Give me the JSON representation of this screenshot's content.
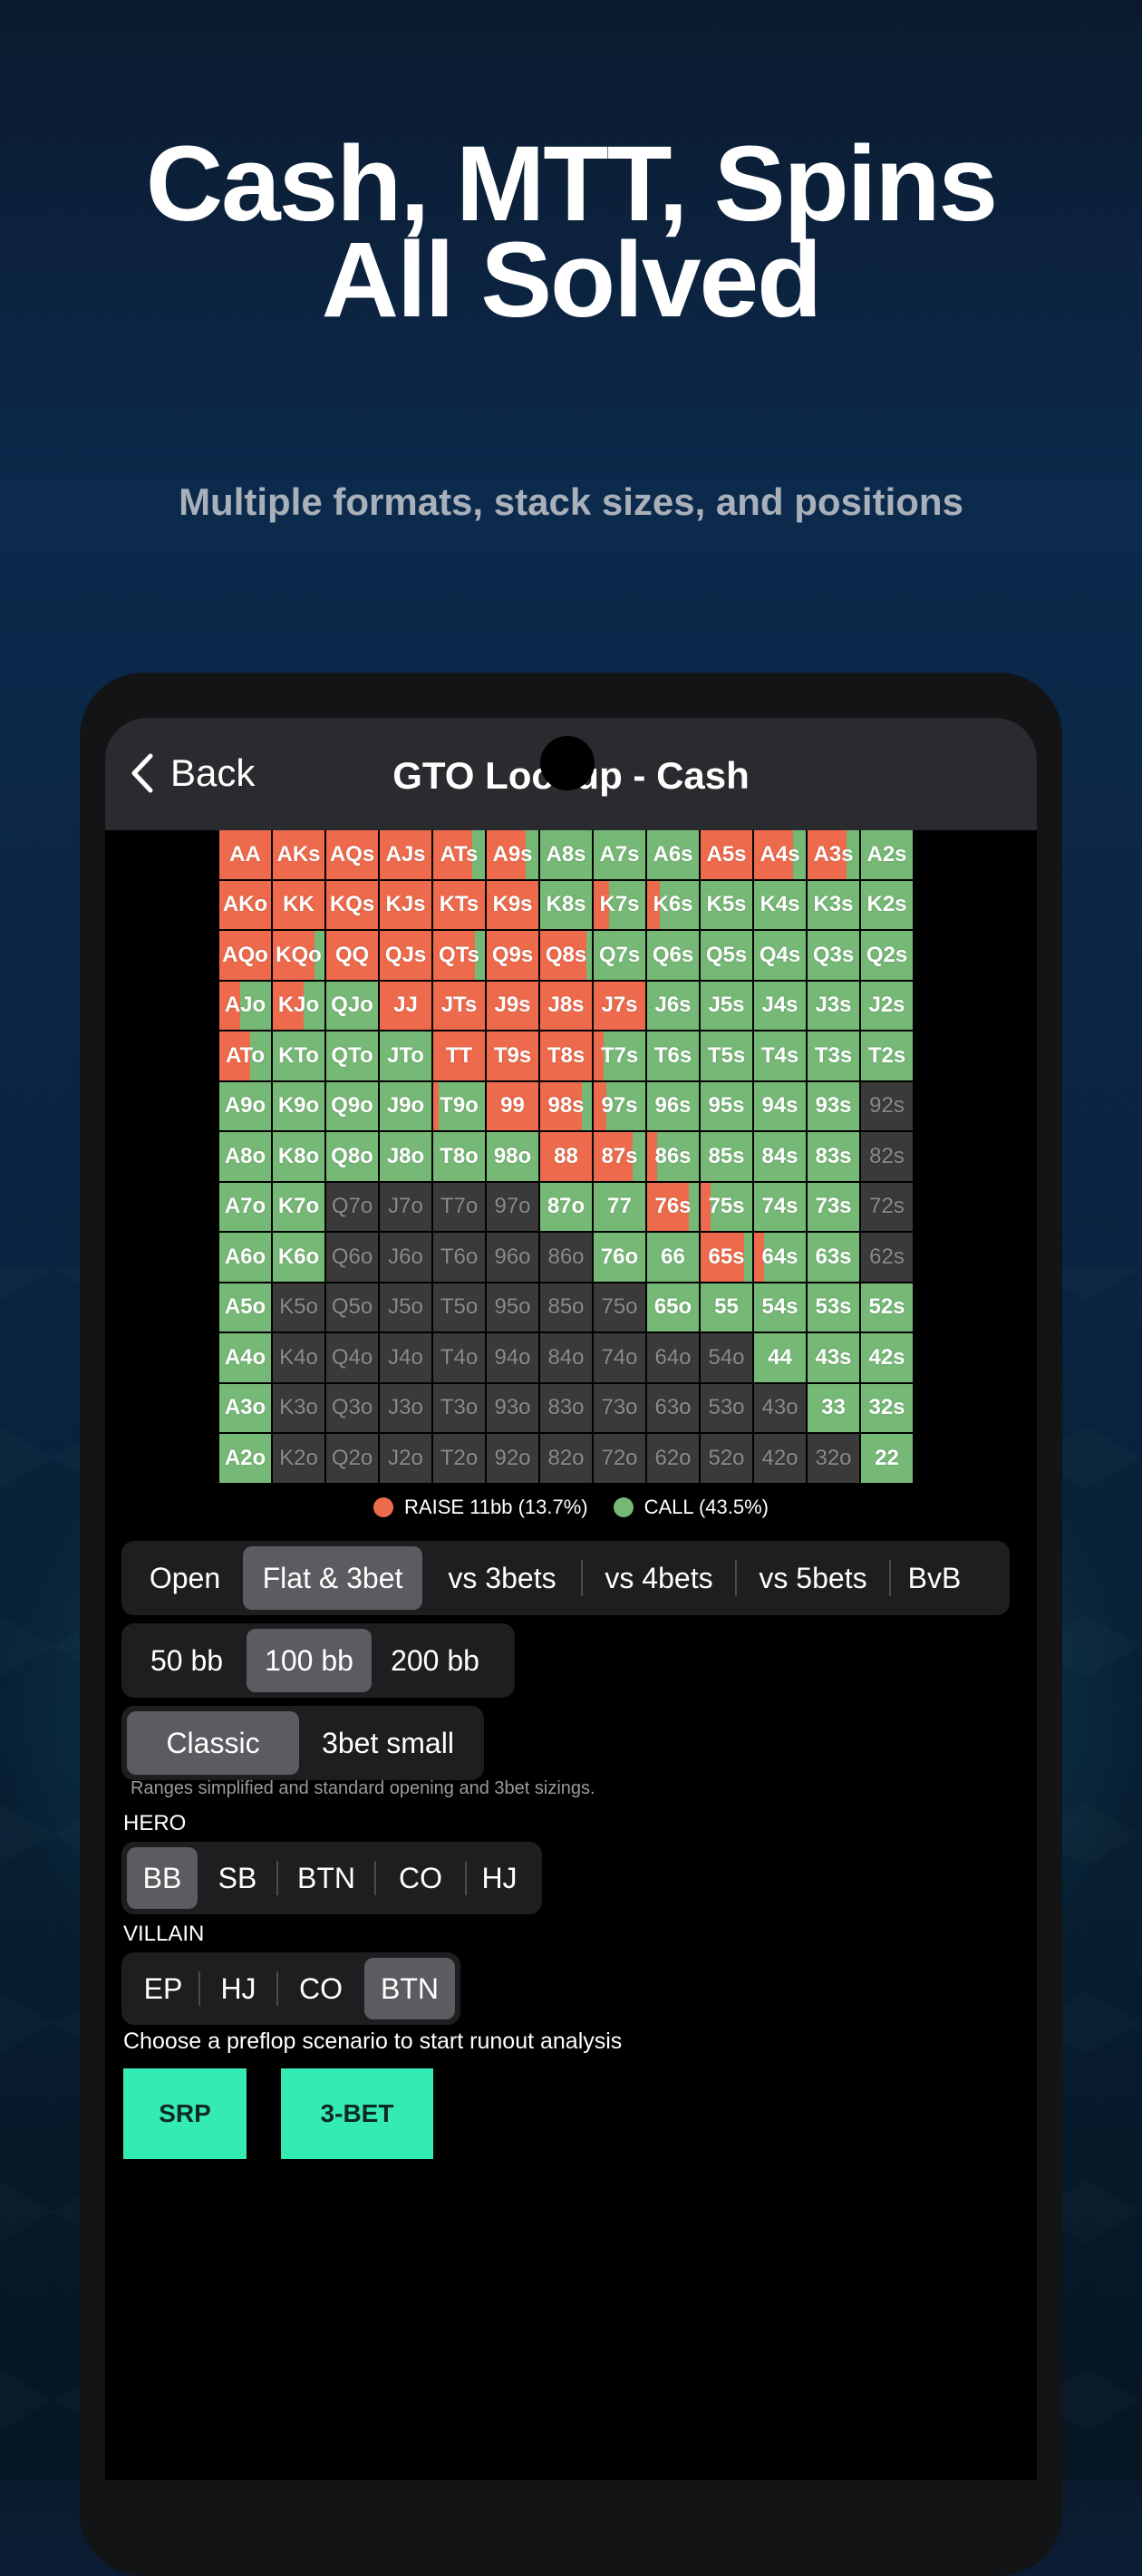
{
  "marketing": {
    "headline_line1": "Cash, MTT, Spins",
    "headline_line2": "All Solved",
    "subheadline": "Multiple formats, stack sizes, and positions"
  },
  "nav": {
    "back_label": "Back",
    "title": "GTO Lookup - Cash"
  },
  "colors": {
    "raise": "#ee6a4c",
    "call": "#76b876",
    "fold": "#3a3a3a",
    "accent": "#35ebb4"
  },
  "grid": {
    "rows": [
      [
        [
          "AA",
          100,
          0
        ],
        [
          "AKs",
          100,
          0
        ],
        [
          "AQs",
          100,
          0
        ],
        [
          "AJs",
          100,
          0
        ],
        [
          "ATs",
          75,
          25
        ],
        [
          "A9s",
          75,
          25
        ],
        [
          "A8s",
          0,
          100
        ],
        [
          "A7s",
          0,
          100
        ],
        [
          "A6s",
          0,
          100
        ],
        [
          "A5s",
          100,
          0
        ],
        [
          "A4s",
          75,
          25
        ],
        [
          "A3s",
          75,
          25
        ],
        [
          "A2s",
          0,
          100
        ]
      ],
      [
        [
          "AKo",
          100,
          0
        ],
        [
          "KK",
          100,
          0
        ],
        [
          "KQs",
          100,
          0
        ],
        [
          "KJs",
          100,
          0
        ],
        [
          "KTs",
          100,
          0
        ],
        [
          "K9s",
          100,
          0
        ],
        [
          "K8s",
          0,
          100
        ],
        [
          "K7s",
          30,
          70
        ],
        [
          "K6s",
          25,
          75
        ],
        [
          "K5s",
          0,
          100
        ],
        [
          "K4s",
          0,
          100
        ],
        [
          "K3s",
          0,
          100
        ],
        [
          "K2s",
          0,
          100
        ]
      ],
      [
        [
          "AQo",
          100,
          0
        ],
        [
          "KQo",
          80,
          20
        ],
        [
          "QQ",
          100,
          0
        ],
        [
          "QJs",
          100,
          0
        ],
        [
          "QTs",
          80,
          20
        ],
        [
          "Q9s",
          100,
          0
        ],
        [
          "Q8s",
          90,
          10
        ],
        [
          "Q7s",
          0,
          100
        ],
        [
          "Q6s",
          0,
          100
        ],
        [
          "Q5s",
          0,
          100
        ],
        [
          "Q4s",
          0,
          100
        ],
        [
          "Q3s",
          0,
          100
        ],
        [
          "Q2s",
          0,
          100
        ]
      ],
      [
        [
          "AJo",
          40,
          60
        ],
        [
          "KJo",
          60,
          40
        ],
        [
          "QJo",
          0,
          100
        ],
        [
          "JJ",
          100,
          0
        ],
        [
          "JTs",
          100,
          0
        ],
        [
          "J9s",
          100,
          0
        ],
        [
          "J8s",
          100,
          0
        ],
        [
          "J7s",
          100,
          0
        ],
        [
          "J6s",
          0,
          100
        ],
        [
          "J5s",
          0,
          100
        ],
        [
          "J4s",
          0,
          100
        ],
        [
          "J3s",
          0,
          100
        ],
        [
          "J2s",
          0,
          100
        ]
      ],
      [
        [
          "ATo",
          60,
          40
        ],
        [
          "KTo",
          0,
          100
        ],
        [
          "QTo",
          0,
          100
        ],
        [
          "JTo",
          0,
          100
        ],
        [
          "TT",
          100,
          0
        ],
        [
          "T9s",
          100,
          0
        ],
        [
          "T8s",
          100,
          0
        ],
        [
          "T7s",
          20,
          80
        ],
        [
          "T6s",
          0,
          100
        ],
        [
          "T5s",
          0,
          100
        ],
        [
          "T4s",
          0,
          100
        ],
        [
          "T3s",
          0,
          100
        ],
        [
          "T2s",
          0,
          100
        ]
      ],
      [
        [
          "A9o",
          0,
          100
        ],
        [
          "K9o",
          0,
          100
        ],
        [
          "Q9o",
          0,
          100
        ],
        [
          "J9o",
          0,
          100
        ],
        [
          "T9o",
          10,
          90
        ],
        [
          "99",
          100,
          0
        ],
        [
          "98s",
          80,
          20
        ],
        [
          "97s",
          25,
          75
        ],
        [
          "96s",
          0,
          100
        ],
        [
          "95s",
          0,
          100
        ],
        [
          "94s",
          0,
          100
        ],
        [
          "93s",
          0,
          100
        ],
        [
          "92s",
          0,
          0
        ]
      ],
      [
        [
          "A8o",
          0,
          100
        ],
        [
          "K8o",
          0,
          100
        ],
        [
          "Q8o",
          0,
          100
        ],
        [
          "J8o",
          0,
          100
        ],
        [
          "T8o",
          0,
          100
        ],
        [
          "98o",
          0,
          100
        ],
        [
          "88",
          100,
          0
        ],
        [
          "87s",
          75,
          25
        ],
        [
          "86s",
          20,
          80
        ],
        [
          "85s",
          0,
          100
        ],
        [
          "84s",
          0,
          100
        ],
        [
          "83s",
          0,
          100
        ],
        [
          "82s",
          0,
          0
        ]
      ],
      [
        [
          "A7o",
          0,
          100
        ],
        [
          "K7o",
          0,
          100
        ],
        [
          "Q7o",
          0,
          0
        ],
        [
          "J7o",
          0,
          0
        ],
        [
          "T7o",
          0,
          0
        ],
        [
          "97o",
          0,
          0
        ],
        [
          "87o",
          0,
          100
        ],
        [
          "77",
          0,
          100
        ],
        [
          "76s",
          80,
          20
        ],
        [
          "75s",
          20,
          80
        ],
        [
          "74s",
          0,
          100
        ],
        [
          "73s",
          0,
          100
        ],
        [
          "72s",
          0,
          0
        ]
      ],
      [
        [
          "A6o",
          0,
          100
        ],
        [
          "K6o",
          0,
          100
        ],
        [
          "Q6o",
          0,
          0
        ],
        [
          "J6o",
          0,
          0
        ],
        [
          "T6o",
          0,
          0
        ],
        [
          "96o",
          0,
          0
        ],
        [
          "86o",
          0,
          0
        ],
        [
          "76o",
          0,
          100
        ],
        [
          "66",
          0,
          100
        ],
        [
          "65s",
          85,
          15
        ],
        [
          "64s",
          20,
          80
        ],
        [
          "63s",
          0,
          100
        ],
        [
          "62s",
          0,
          0
        ]
      ],
      [
        [
          "A5o",
          0,
          100
        ],
        [
          "K5o",
          0,
          0
        ],
        [
          "Q5o",
          0,
          0
        ],
        [
          "J5o",
          0,
          0
        ],
        [
          "T5o",
          0,
          0
        ],
        [
          "95o",
          0,
          0
        ],
        [
          "85o",
          0,
          0
        ],
        [
          "75o",
          0,
          0
        ],
        [
          "65o",
          0,
          100
        ],
        [
          "55",
          0,
          100
        ],
        [
          "54s",
          0,
          100
        ],
        [
          "53s",
          0,
          100
        ],
        [
          "52s",
          0,
          100
        ]
      ],
      [
        [
          "A4o",
          0,
          100
        ],
        [
          "K4o",
          0,
          0
        ],
        [
          "Q4o",
          0,
          0
        ],
        [
          "J4o",
          0,
          0
        ],
        [
          "T4o",
          0,
          0
        ],
        [
          "94o",
          0,
          0
        ],
        [
          "84o",
          0,
          0
        ],
        [
          "74o",
          0,
          0
        ],
        [
          "64o",
          0,
          0
        ],
        [
          "54o",
          0,
          0
        ],
        [
          "44",
          0,
          100
        ],
        [
          "43s",
          0,
          100
        ],
        [
          "42s",
          0,
          100
        ]
      ],
      [
        [
          "A3o",
          0,
          100
        ],
        [
          "K3o",
          0,
          0
        ],
        [
          "Q3o",
          0,
          0
        ],
        [
          "J3o",
          0,
          0
        ],
        [
          "T3o",
          0,
          0
        ],
        [
          "93o",
          0,
          0
        ],
        [
          "83o",
          0,
          0
        ],
        [
          "73o",
          0,
          0
        ],
        [
          "63o",
          0,
          0
        ],
        [
          "53o",
          0,
          0
        ],
        [
          "43o",
          0,
          0
        ],
        [
          "33",
          0,
          100
        ],
        [
          "32s",
          0,
          100
        ]
      ],
      [
        [
          "A2o",
          0,
          100
        ],
        [
          "K2o",
          0,
          0
        ],
        [
          "Q2o",
          0,
          0
        ],
        [
          "J2o",
          0,
          0
        ],
        [
          "T2o",
          0,
          0
        ],
        [
          "92o",
          0,
          0
        ],
        [
          "82o",
          0,
          0
        ],
        [
          "72o",
          0,
          0
        ],
        [
          "62o",
          0,
          0
        ],
        [
          "52o",
          0,
          0
        ],
        [
          "42o",
          0,
          0
        ],
        [
          "32o",
          0,
          0
        ],
        [
          "22",
          0,
          100
        ]
      ]
    ]
  },
  "legend": {
    "raise_label": "RAISE 11bb (13.7%)",
    "call_label": "CALL (43.5%)"
  },
  "scenario_tabs": [
    "Open",
    "Flat & 3bet",
    "vs 3bets",
    "vs 4bets",
    "vs 5bets",
    "BvB"
  ],
  "scenario_selected": "Flat & 3bet",
  "stack_tabs": [
    "50 bb",
    "100 bb",
    "200 bb"
  ],
  "stack_selected": "100 bb",
  "sizing_tabs": [
    "Classic",
    "3bet small"
  ],
  "sizing_selected": "Classic",
  "sizing_note": "Ranges simplified and standard opening and 3bet sizings.",
  "hero": {
    "label": "HERO",
    "options": [
      "BB",
      "SB",
      "BTN",
      "CO",
      "HJ"
    ],
    "selected": "BB"
  },
  "villain": {
    "label": "VILLAIN",
    "options": [
      "EP",
      "HJ",
      "CO",
      "BTN"
    ],
    "selected": "BTN"
  },
  "runout": {
    "prompt": "Choose a preflop scenario to start runout analysis",
    "srp_label": "SRP",
    "threebet_label": "3-BET"
  }
}
